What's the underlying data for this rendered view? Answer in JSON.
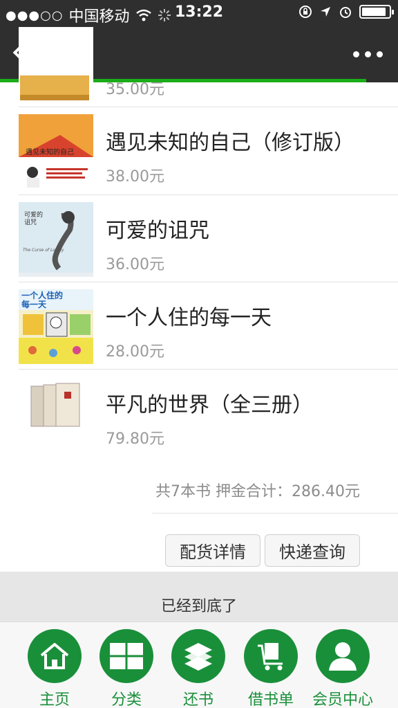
{
  "status_bar": {
    "signal": "●●●○○",
    "carrier": "中国移动",
    "time": "13:22",
    "battery_level": 0.9
  },
  "nav": {
    "back_label": "返回",
    "page_progress": 0.92
  },
  "books": [
    {
      "title": "",
      "price": "35.00元"
    },
    {
      "title": "遇见未知的自己（修订版）",
      "price": "38.00元",
      "cover_text": "遇见未知的自己"
    },
    {
      "title": "可爱的诅咒",
      "price": "36.00元",
      "cover_text": "可爱的诅咒",
      "cover_sub": "The Curse of Lovely"
    },
    {
      "title": "一个人住的每一天",
      "price": "28.00元",
      "cover_text": "一个人住的每一天"
    },
    {
      "title": "平凡的世界（全三册）",
      "price": "79.80元"
    }
  ],
  "summary": "共7本书 押金合计：286.40元",
  "buttons": {
    "delivery_details": "配货详情",
    "express_query": "快递查询"
  },
  "end_text": "已经到底了",
  "tabbar": [
    {
      "label": "主页",
      "icon": "home-icon"
    },
    {
      "label": "分类",
      "icon": "grid-icon"
    },
    {
      "label": "还书",
      "icon": "books-stack-icon"
    },
    {
      "label": "借书单",
      "icon": "cart-icon"
    },
    {
      "label": "会员中心",
      "icon": "user-icon"
    }
  ],
  "colors": {
    "brand_green": "#1a8f3a",
    "progress_green": "#1aad19",
    "header": "#2f2f2f"
  }
}
